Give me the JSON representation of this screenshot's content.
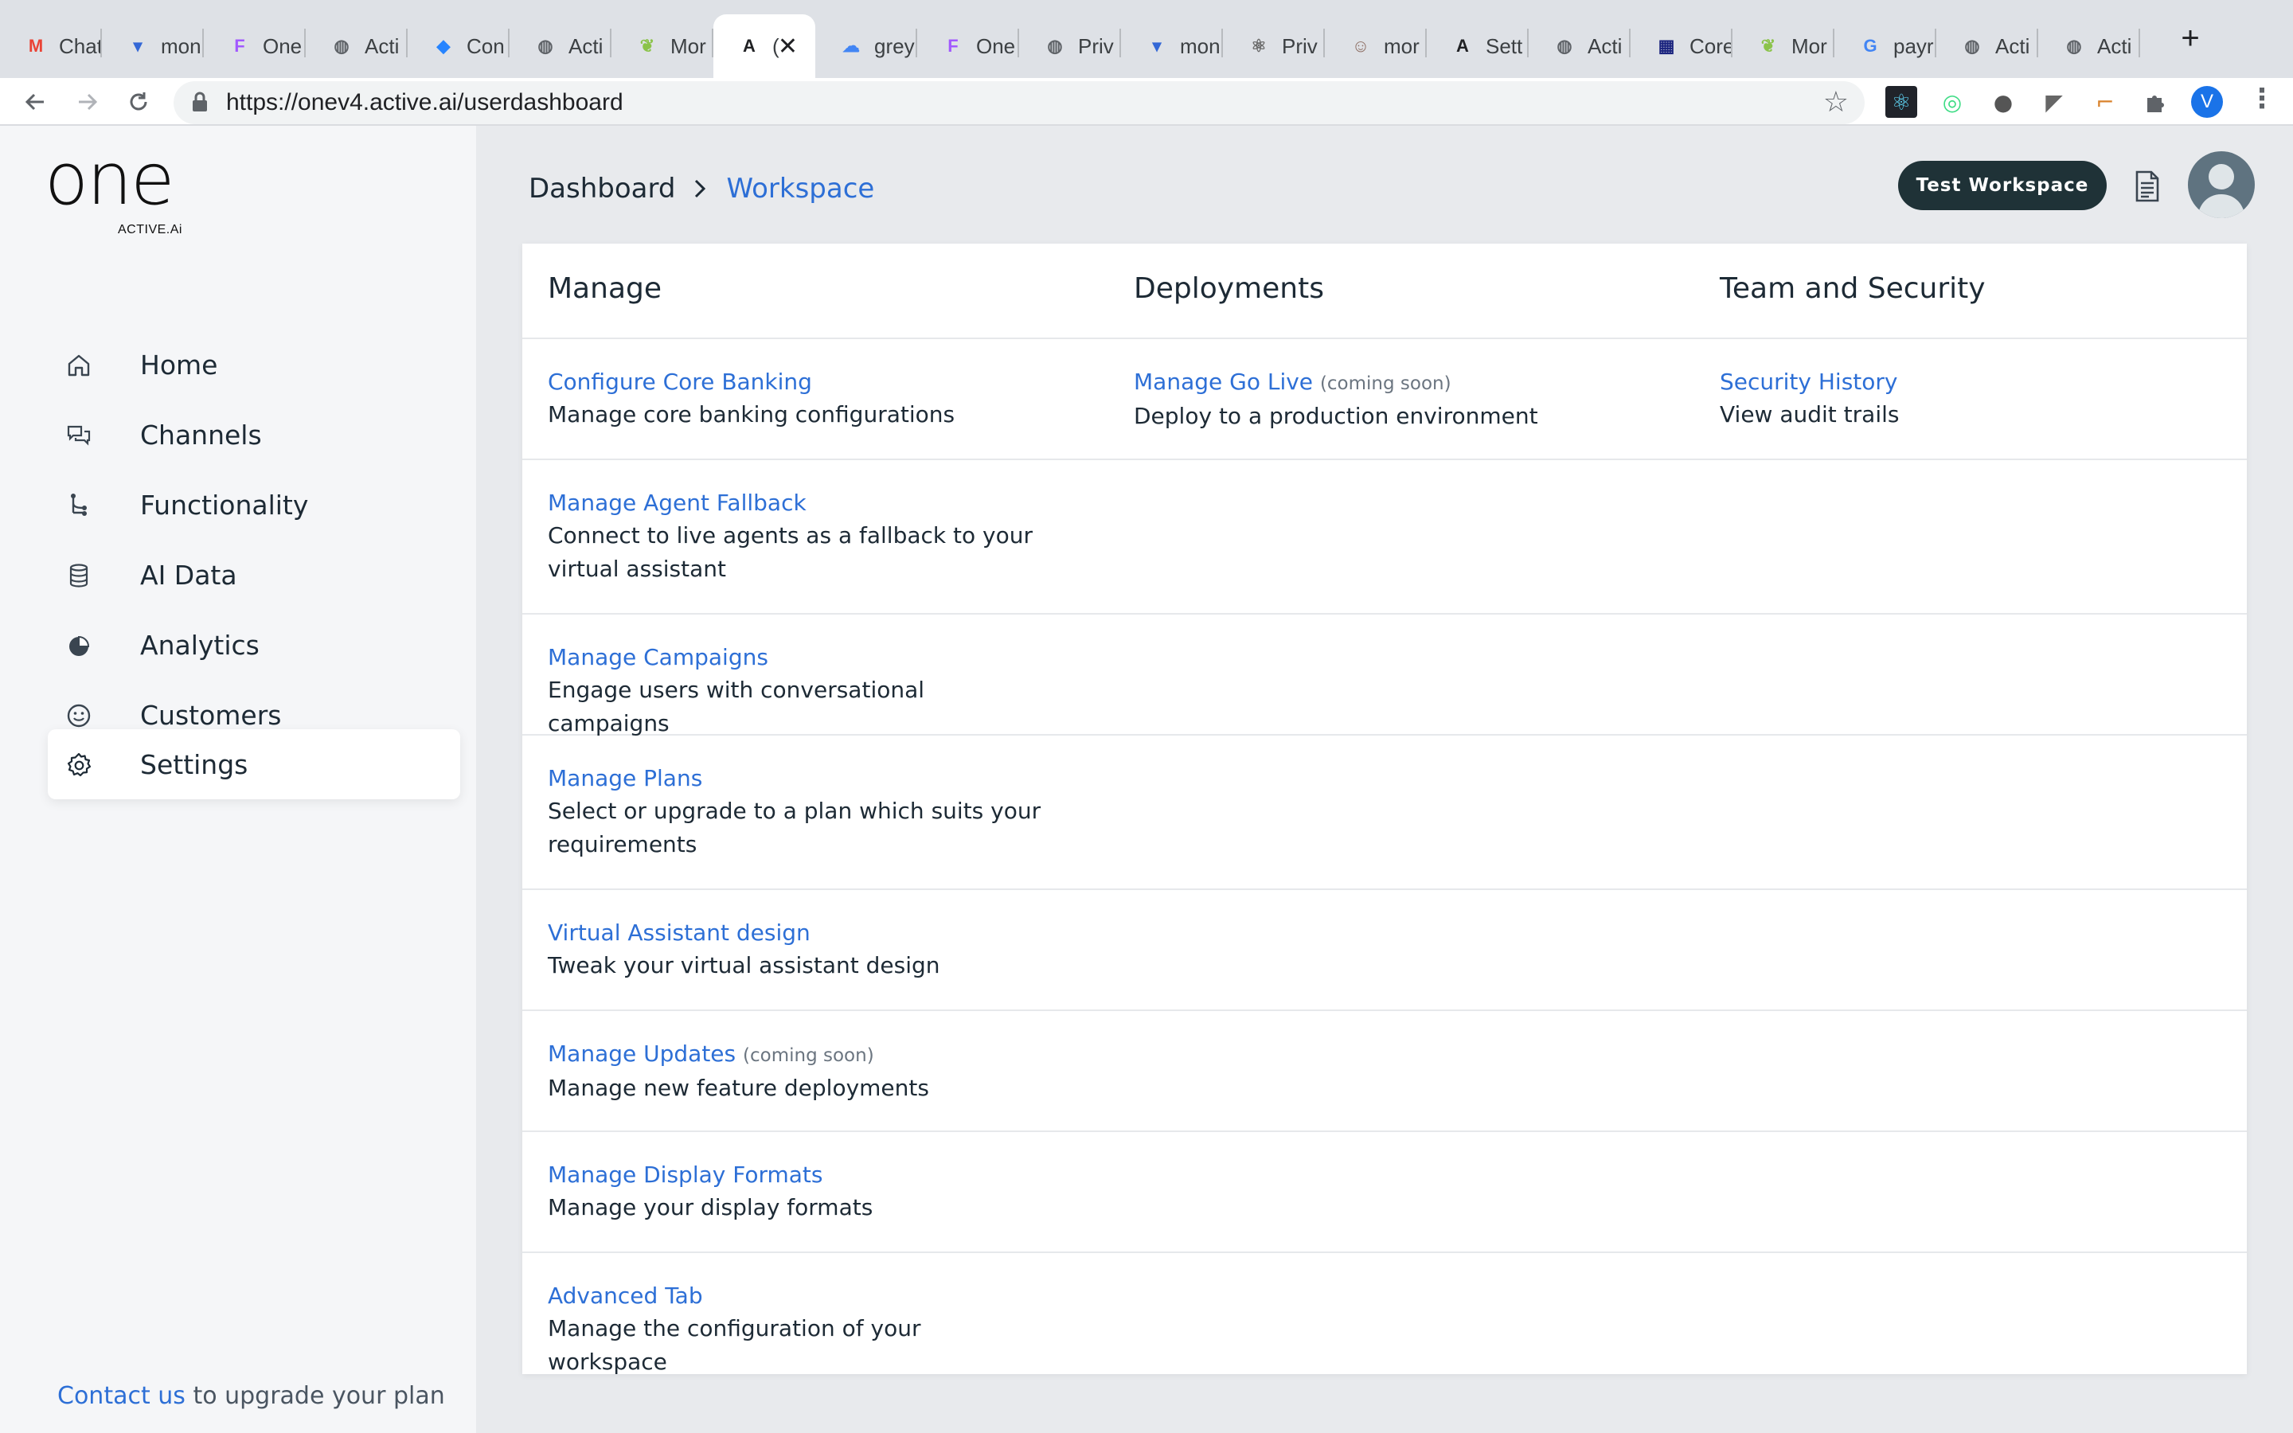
{
  "browser": {
    "tabs": [
      {
        "title": "Chat",
        "fav_color": "#ea4335",
        "fav_glyph": "M"
      },
      {
        "title": "mon",
        "fav_color": "#3367d6",
        "fav_glyph": "▾"
      },
      {
        "title": "One",
        "fav_color": "#a259ff",
        "fav_glyph": "F"
      },
      {
        "title": "Acti",
        "fav_color": "#5f6368",
        "fav_glyph": "◍"
      },
      {
        "title": "Con",
        "fav_color": "#2684ff",
        "fav_glyph": "◆"
      },
      {
        "title": "Acti",
        "fav_color": "#5f6368",
        "fav_glyph": "◍"
      },
      {
        "title": "Mor",
        "fav_color": "#8bc34a",
        "fav_glyph": "❦"
      },
      {
        "title": "(",
        "fav_color": "#202124",
        "fav_glyph": "A"
      },
      {
        "title": "grey",
        "fav_color": "#4285f4",
        "fav_glyph": "☁"
      },
      {
        "title": "One",
        "fav_color": "#a259ff",
        "fav_glyph": "F"
      },
      {
        "title": "Priv",
        "fav_color": "#5f6368",
        "fav_glyph": "◍"
      },
      {
        "title": "mon",
        "fav_color": "#3367d6",
        "fav_glyph": "▾"
      },
      {
        "title": "Priv",
        "fav_color": "#6b6b6b",
        "fav_glyph": "⚛"
      },
      {
        "title": "mor",
        "fav_color": "#8d6e63",
        "fav_glyph": "☺"
      },
      {
        "title": "Sett",
        "fav_color": "#202124",
        "fav_glyph": "A"
      },
      {
        "title": "Acti",
        "fav_color": "#5f6368",
        "fav_glyph": "◍"
      },
      {
        "title": "Core",
        "fav_color": "#1a237e",
        "fav_glyph": "▦"
      },
      {
        "title": "Mor",
        "fav_color": "#8bc34a",
        "fav_glyph": "❦"
      },
      {
        "title": "payr",
        "fav_color": "#ffffff",
        "fav_glyph": "G"
      },
      {
        "title": "Acti",
        "fav_color": "#5f6368",
        "fav_glyph": "◍"
      },
      {
        "title": "Acti",
        "fav_color": "#5f6368",
        "fav_glyph": "◍"
      }
    ],
    "active_tab_index": 7,
    "new_tab_label": "+",
    "url": "https://onev4.active.ai/userdashboard",
    "profile_initial": "V"
  },
  "brand": {
    "name": "one",
    "sub": "ACTIVE.Ai"
  },
  "sidebar": {
    "items": [
      {
        "label": "Home",
        "icon": "home-icon"
      },
      {
        "label": "Channels",
        "icon": "chat-icon"
      },
      {
        "label": "Functionality",
        "icon": "flow-icon"
      },
      {
        "label": "AI Data",
        "icon": "database-icon"
      },
      {
        "label": "Analytics",
        "icon": "pie-chart-icon"
      },
      {
        "label": "Customers",
        "icon": "smiley-icon"
      },
      {
        "label": "Settings",
        "icon": "gear-icon",
        "active": true
      }
    ],
    "contact_link": "Contact us",
    "contact_text": " to upgrade your plan"
  },
  "header": {
    "breadcrumb_root": "Dashboard",
    "breadcrumb_current": "Workspace",
    "workspace_button": "Test Workspace"
  },
  "settings": {
    "columns": [
      "Manage",
      "Deployments",
      "Team and Security"
    ],
    "rows": [
      {
        "cells": [
          {
            "title": "Configure Core Banking",
            "desc": "Manage core banking configurations"
          },
          {
            "title": "Manage Go Live",
            "note": "(coming soon)",
            "desc": "Deploy to a production environment"
          },
          {
            "title": "Security History",
            "desc": "View audit trails"
          }
        ]
      },
      {
        "cells": [
          {
            "title": "Manage Agent Fallback",
            "desc": "Connect to live agents as a fallback to your virtual assistant"
          }
        ]
      },
      {
        "cells": [
          {
            "title": "Manage Campaigns",
            "desc": "Engage users with conversational campaigns"
          }
        ]
      },
      {
        "cells": [
          {
            "title": "Manage Plans",
            "desc": "Select or upgrade to a plan which suits your requirements"
          }
        ]
      },
      {
        "cells": [
          {
            "title": "Virtual Assistant design",
            "desc": "Tweak your virtual assistant design"
          }
        ]
      },
      {
        "cells": [
          {
            "title": "Manage Updates",
            "note": "(coming soon)",
            "desc": "Manage new feature deployments"
          }
        ]
      },
      {
        "cells": [
          {
            "title": "Manage Display Formats",
            "desc": "Manage your display formats"
          }
        ]
      },
      {
        "cells": [
          {
            "title": "Advanced Tab",
            "desc": "Manage the configuration of your workspace"
          }
        ]
      }
    ]
  },
  "colors": {
    "link": "#2d6fd6",
    "dark_button": "#1f3237",
    "sidebar_bg": "#f5f6f8"
  }
}
